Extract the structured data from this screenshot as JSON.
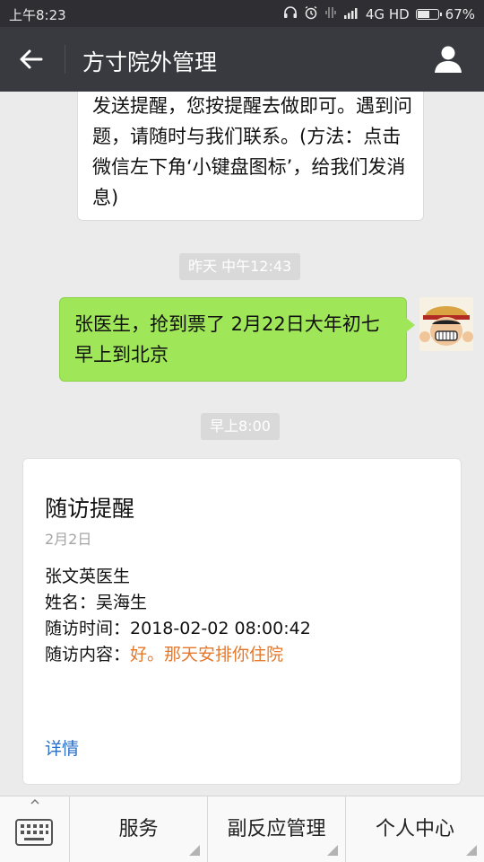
{
  "status_bar": {
    "time": "上午8:23",
    "network": "4G HD",
    "battery": "67%",
    "battery_level": 0.67
  },
  "header": {
    "title": "方寸院外管理",
    "back_icon": "arrow-left-icon",
    "profile_icon": "person-icon"
  },
  "chat": {
    "incoming_text": "发送提醒，您按提醒去做即可。遇到问题，请随时与我们联系。(方法：点击微信左下角‘小键盘图标’，给我们发消息)",
    "timestamp_1": "昨天 中午12:43",
    "outgoing_text": "张医生，抢到票了 2月22日大年初七早上到北京",
    "timestamp_2": "早上8:00",
    "card": {
      "title": "随访提醒",
      "date": "2月2日",
      "doctor": "张文英医生",
      "name_label": "姓名：",
      "name_value": "吴海生",
      "time_label": "随访时间：",
      "time_value": "2018-02-02 08:00:42",
      "content_label": "随访内容：",
      "content_value": "好。那天安排你住院",
      "detail_link": "详情"
    }
  },
  "menu": {
    "keyboard_icon": "keyboard-icon",
    "items": [
      {
        "label": "服务"
      },
      {
        "label": "副反应管理"
      },
      {
        "label": "个人中心"
      }
    ]
  },
  "colors": {
    "nav_bg": "#393a3f",
    "outgoing_bubble": "#9fe658",
    "link": "#2a6ec4",
    "highlight": "#e5782a"
  }
}
